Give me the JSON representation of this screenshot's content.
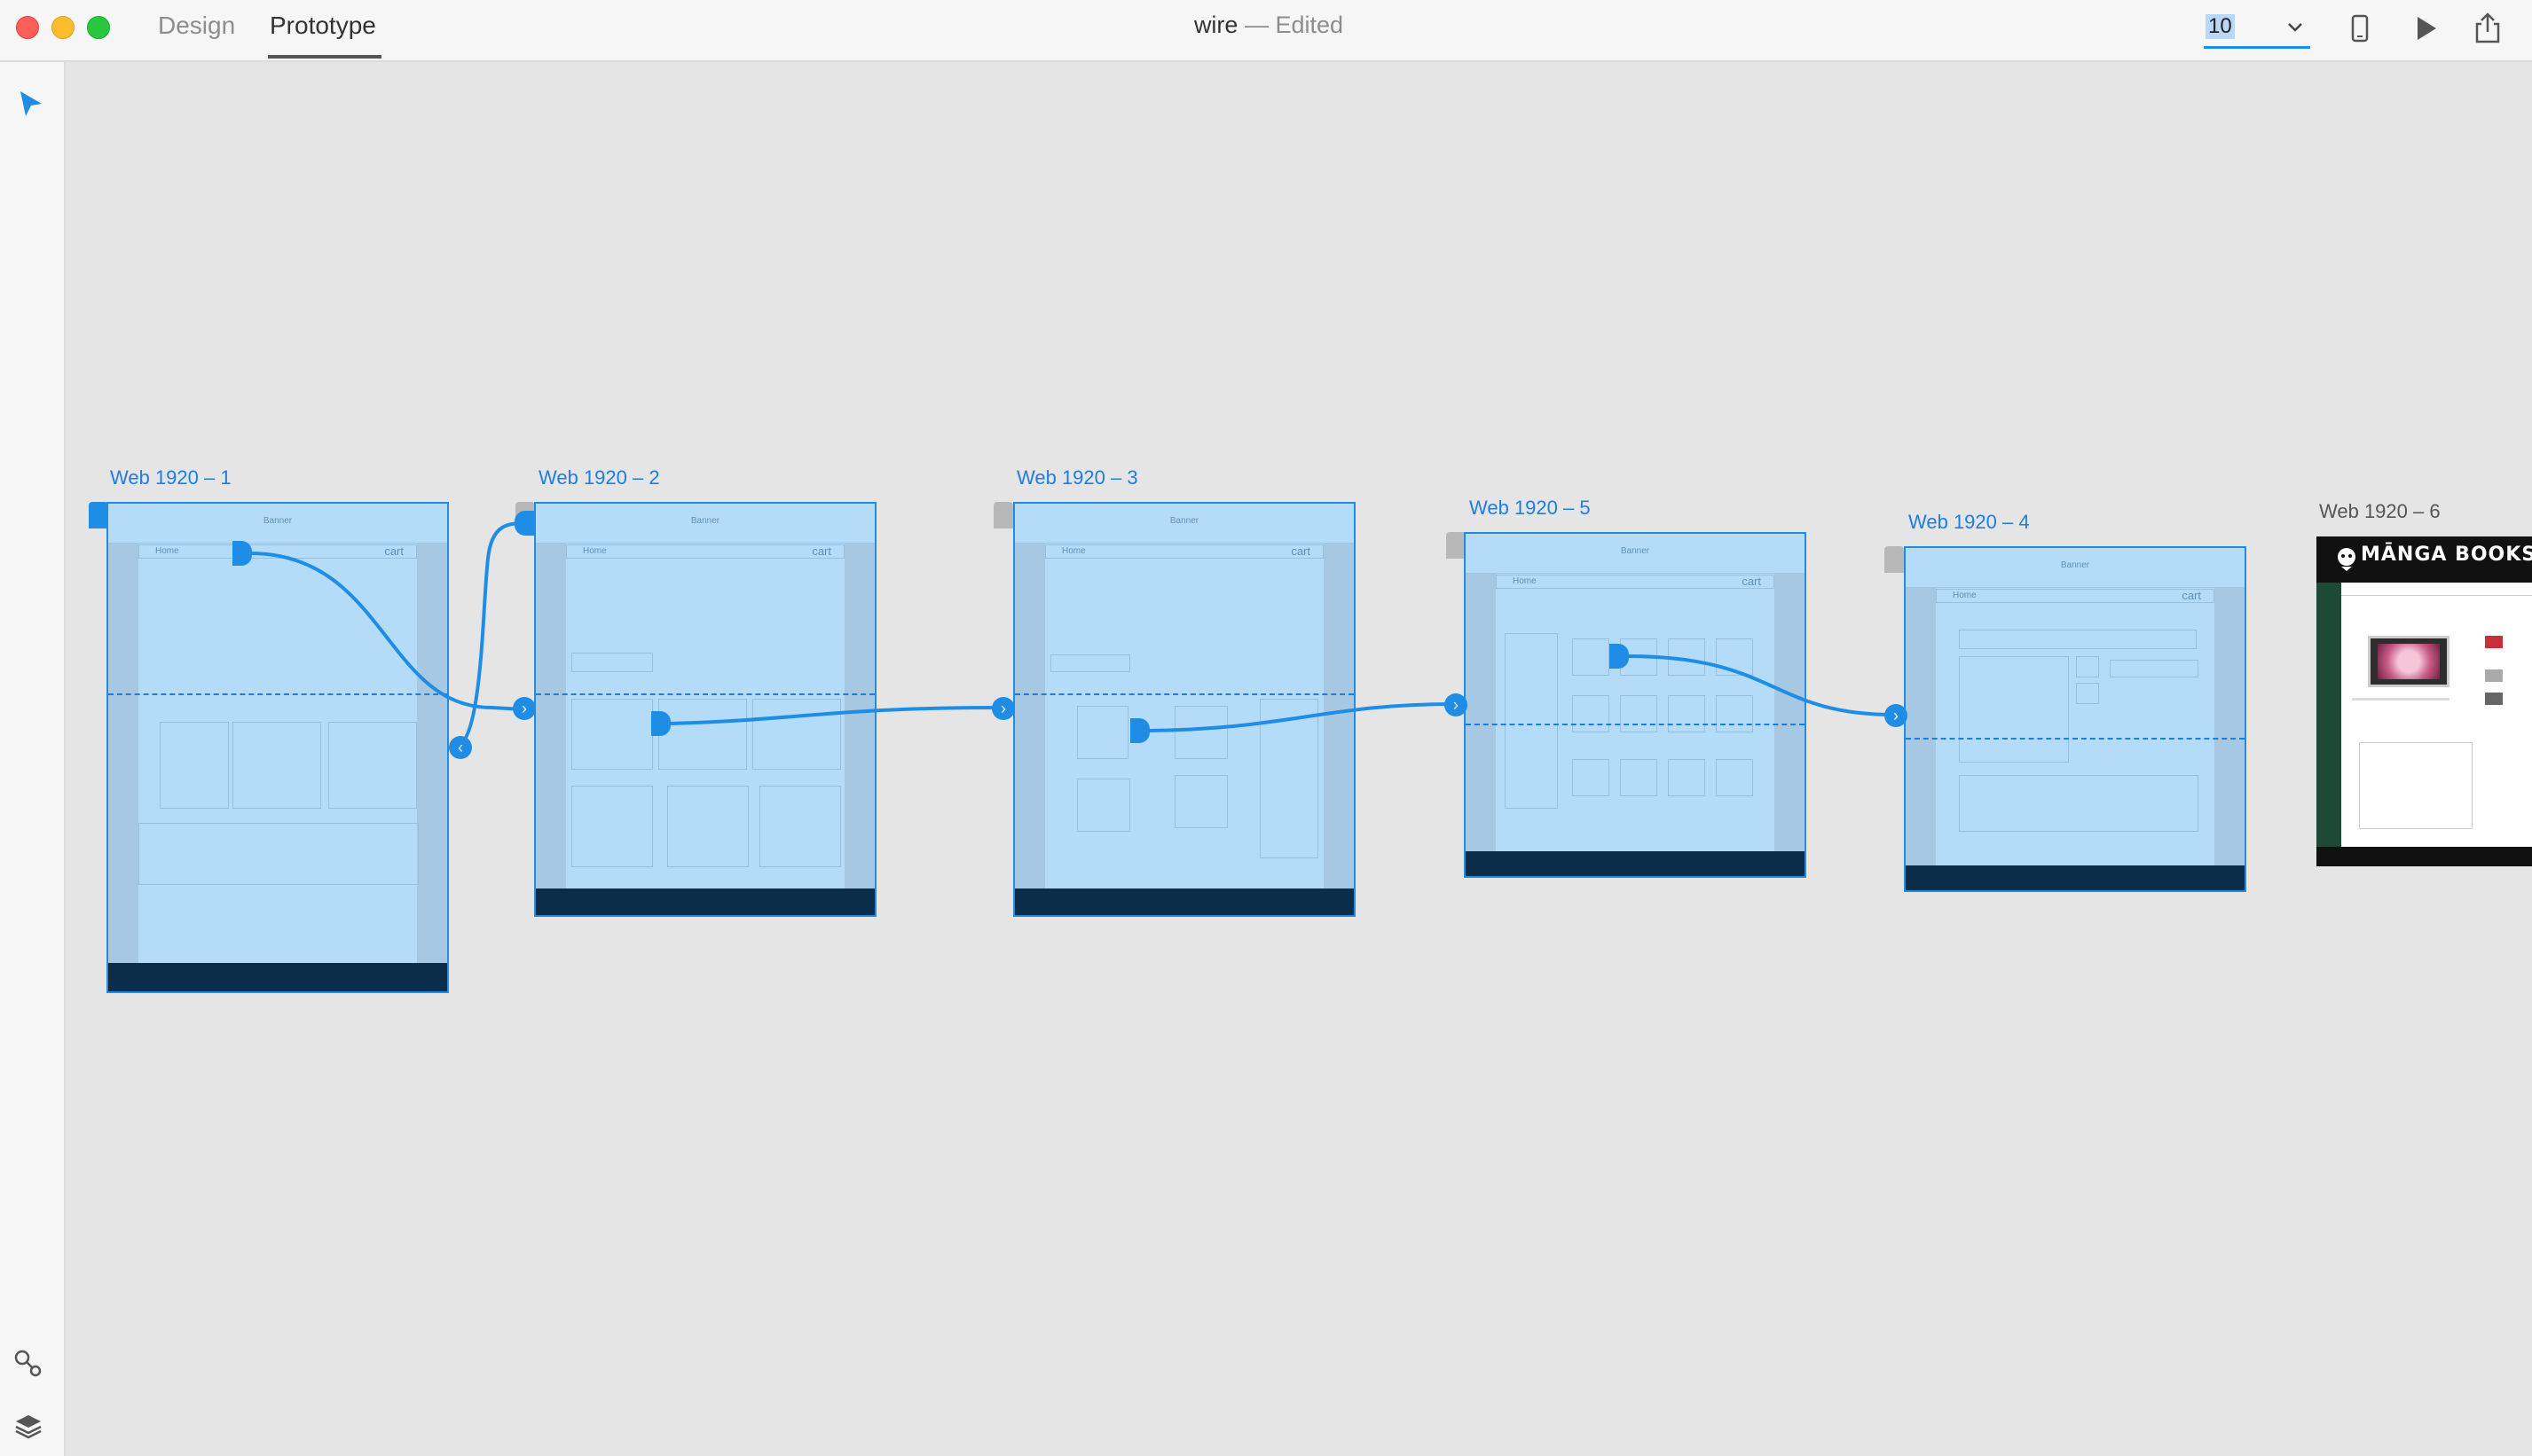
{
  "window": {
    "tabs": [
      "Design",
      "Prototype"
    ],
    "active_tab": "Prototype",
    "doc_name": "wire",
    "separator": "—",
    "doc_status": "Edited",
    "zoom": "10"
  },
  "artboards": [
    {
      "label": "Web 1920 – 1",
      "banner": "Banner",
      "home": "Home",
      "cart": "cart"
    },
    {
      "label": "Web 1920 – 2",
      "banner": "Banner",
      "home": "Home",
      "cart": "cart"
    },
    {
      "label": "Web 1920 – 3",
      "banner": "Banner",
      "home": "Home",
      "cart": "cart"
    },
    {
      "label": "Web 1920 – 5",
      "banner": "Banner",
      "home": "Home",
      "cart": "cart"
    },
    {
      "label": "Web 1920 – 4",
      "banner": "Banner",
      "home": "Home",
      "cart": "cart"
    },
    {
      "label": "Web 1920 – 6",
      "logo": "MĀNGA BOOKSTOR"
    }
  ],
  "colors": {
    "accent": "#1f8ce6",
    "artboard_fill": "#b4dcf8",
    "footer": "#0b2d4a",
    "canvas": "#e5e5e5"
  },
  "icons": [
    "select-tool-icon",
    "link-icon",
    "layers-icon",
    "device-icon",
    "play-icon",
    "share-icon"
  ]
}
